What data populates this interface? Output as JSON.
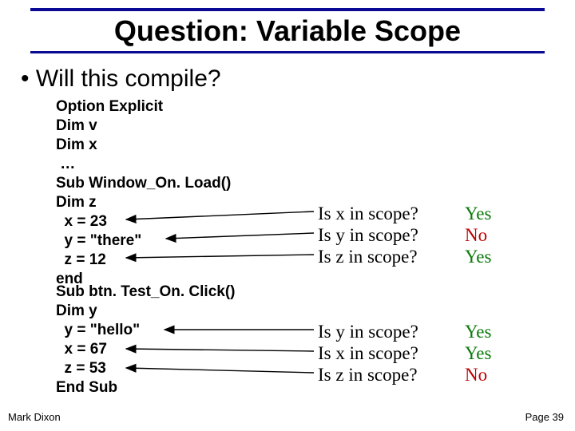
{
  "title": "Question: Variable Scope",
  "bullet": "• Will this compile?",
  "code_block_1": "Option Explicit\nDim v\nDim x\n …\nSub Window_On. Load()\nDim z\n  x = 23\n  y = \"there\"\n  z = 12\nend",
  "code_block_2": "Sub btn. Test_On. Click()\nDim y\n  y = \"hello\"\n  x = 67\n  z = 53\nEnd Sub",
  "questions_top": [
    "Is x in scope?",
    "Is y in scope?",
    "Is z in scope?"
  ],
  "answers_top": [
    {
      "text": "Yes",
      "cls": "yes"
    },
    {
      "text": "No",
      "cls": "no"
    },
    {
      "text": "Yes",
      "cls": "yes"
    }
  ],
  "questions_bot": [
    "Is y in scope?",
    "Is x in scope?",
    "Is z in scope?"
  ],
  "answers_bot": [
    {
      "text": "Yes",
      "cls": "yes"
    },
    {
      "text": "Yes",
      "cls": "yes"
    },
    {
      "text": "No",
      "cls": "no"
    }
  ],
  "footer_left": "Mark Dixon",
  "footer_right": "Page 39"
}
